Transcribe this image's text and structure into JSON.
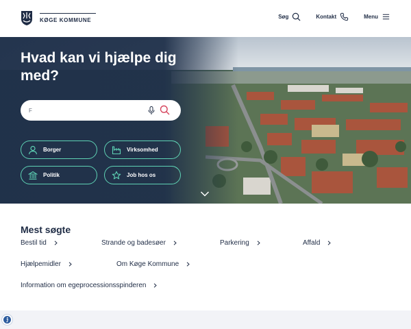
{
  "header": {
    "logo_text": "KØGE KOMMUNE",
    "nav": [
      {
        "label": "Søg",
        "icon": "search-icon"
      },
      {
        "label": "Kontakt",
        "icon": "phone-icon"
      },
      {
        "label": "Menu",
        "icon": "hamburger-icon"
      }
    ]
  },
  "hero": {
    "title": "Hvad kan vi hjælpe dig med?",
    "search_value": "F",
    "buttons": [
      {
        "label": "Borger",
        "icon": "person-icon"
      },
      {
        "label": "Virksomhed",
        "icon": "factory-icon"
      },
      {
        "label": "Politik",
        "icon": "town-hall-icon"
      },
      {
        "label": "Job hos os",
        "icon": "star-icon"
      }
    ]
  },
  "most_searched": {
    "title": "Mest søgte",
    "links": [
      "Bestil tid",
      "Strande og badesøer",
      "Parkering",
      "Affald",
      "Hjælpemidler",
      "Om Køge Kommune",
      "Information om egeprocessionsspinderen"
    ]
  },
  "colors": {
    "navy": "#1f2c45",
    "mint": "#5fd3b5",
    "accent_red": "#d6455d",
    "info_blue": "#2d5c9e"
  }
}
